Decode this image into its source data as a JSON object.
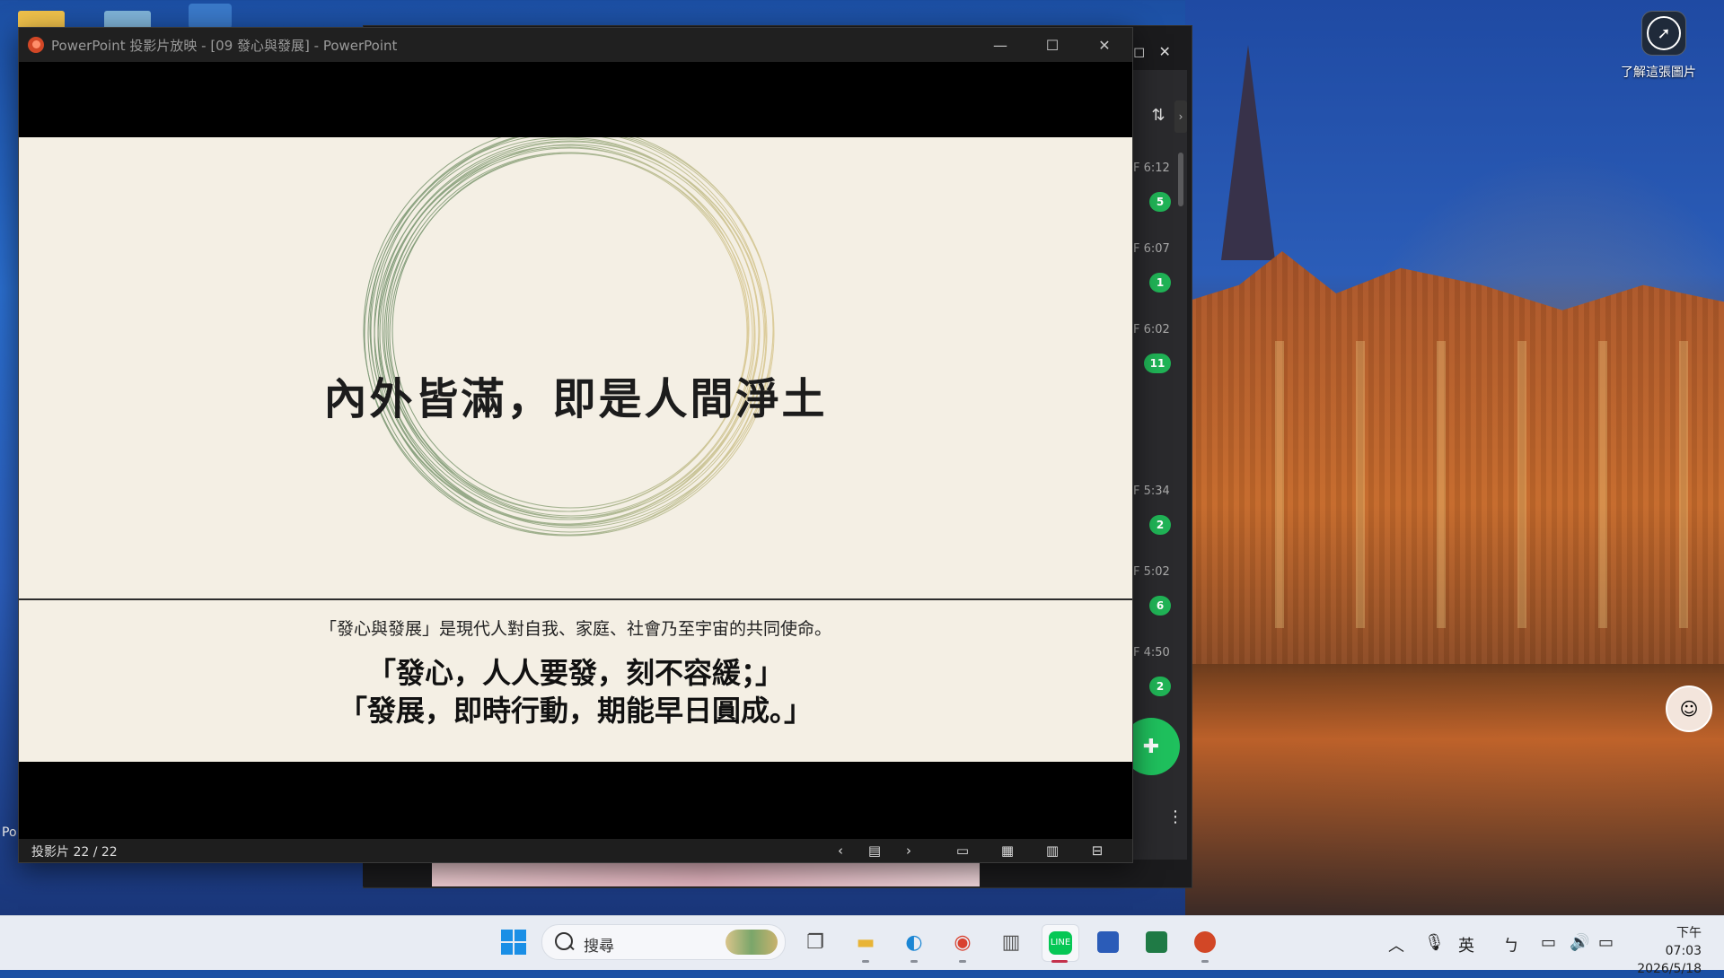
{
  "desktop": {
    "image_info_label": "了解這張圖片",
    "left_partial_label": "Po"
  },
  "line_chat": {
    "times": [
      "F 6:12",
      "F 6:07",
      "F 6:02",
      "F 5:34",
      "F 5:02",
      "F 4:50"
    ],
    "badges": [
      "5",
      "1",
      "11",
      "2",
      "6",
      "2"
    ],
    "badge_color": "#20b356"
  },
  "powerpoint": {
    "title": "PowerPoint 投影片放映 - [09 發心與發展] - PowerPoint",
    "slide": {
      "title": "內外皆滿，即是人間淨土",
      "subtitle": "「發心與發展」是現代人對自我、家庭、社會乃至宇宙的共同使命。",
      "quote_line1": "「發心，人人要發，刻不容緩；」",
      "quote_line2": "「發展，即時行動，期能早日圓成。」",
      "background": "#f4efe4"
    },
    "status": {
      "slide_count": "投影片 22 / 22"
    }
  },
  "taskbar": {
    "search_placeholder": "搜尋",
    "ime": "英",
    "ime2": "ㄅ",
    "clock_time": "下午 07:03",
    "clock_date": "2026/5/18"
  }
}
